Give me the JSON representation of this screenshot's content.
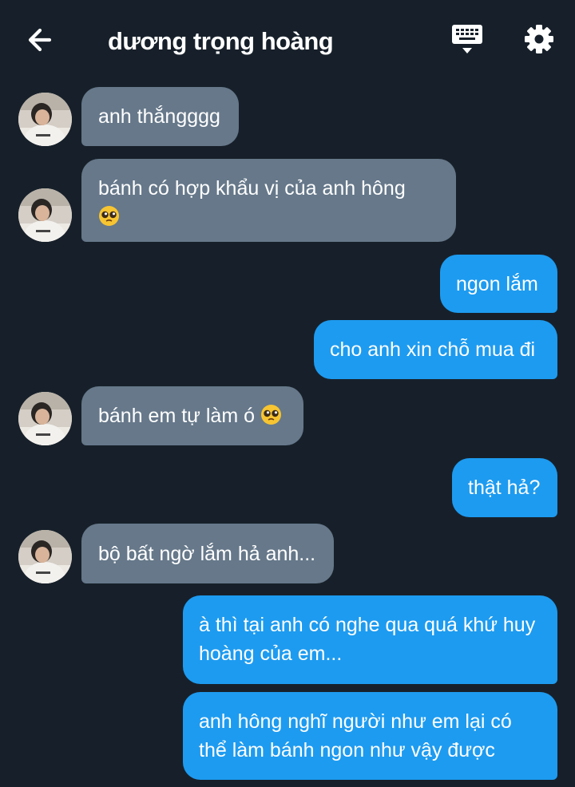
{
  "header": {
    "title": "dương trọng hoàng",
    "back_icon": "arrow-left-icon",
    "keyboard_icon": "keyboard-icon",
    "settings_icon": "gear-icon"
  },
  "messages": [
    {
      "side": "in",
      "text": "anh thắngggg"
    },
    {
      "side": "in",
      "text": "bánh có hợp khẩu vị của anh hông",
      "emoji": "pleading-face"
    },
    {
      "side": "out",
      "text": "ngon lắm"
    },
    {
      "side": "out",
      "text": "cho anh xin chỗ mua đi"
    },
    {
      "side": "in",
      "text": "bánh em tự làm ó",
      "emoji": "pleading-face"
    },
    {
      "side": "out",
      "text": "thật hả?"
    },
    {
      "side": "in",
      "text": "bộ bất ngờ lắm hả anh..."
    },
    {
      "side": "out",
      "text": "à thì tại anh có nghe qua quá khứ huy hoàng của em..."
    },
    {
      "side": "out",
      "text": "anh hông nghĩ người như em lại có thể làm bánh ngon như vậy được"
    }
  ],
  "colors": {
    "background": "#17202a",
    "incoming_bubble": "#66788a",
    "outgoing_bubble": "#1d9bf0",
    "text": "#ffffff"
  }
}
